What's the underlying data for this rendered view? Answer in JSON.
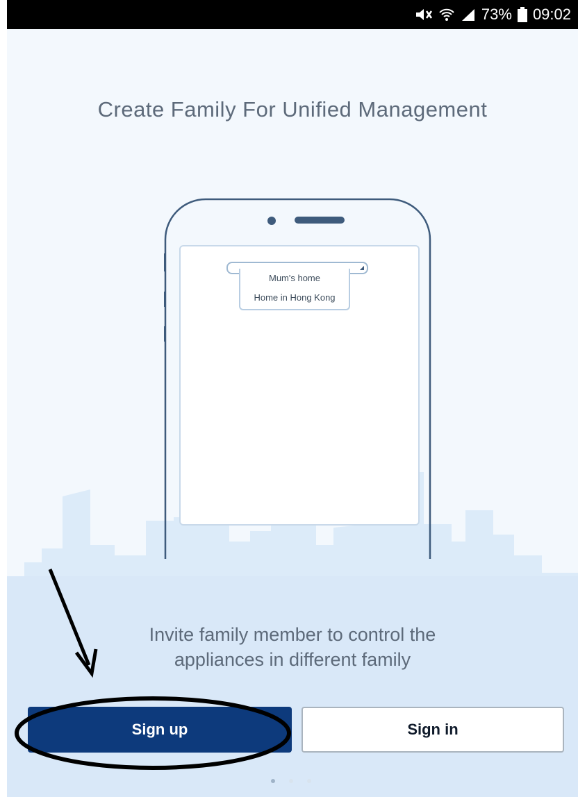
{
  "status_bar": {
    "battery_percent": "73%",
    "time": "09:02",
    "icons": [
      "mute-icon",
      "wifi-icon",
      "signal-icon",
      "battery-icon"
    ]
  },
  "title": "Create Family For Unified Management",
  "illustration": {
    "dropdown_items": [
      "Mum's home",
      "Home in Hong Kong"
    ]
  },
  "caption": {
    "line1": "Invite family member to control the",
    "line2": "appliances in different family"
  },
  "buttons": {
    "signup_label": "Sign up",
    "signin_label": "Sign in"
  },
  "pager": {
    "pages": 3,
    "active": 1
  },
  "colors": {
    "primary": "#0d3a7c",
    "background": "#f3f8fd",
    "skyline": "#dcebf9"
  }
}
